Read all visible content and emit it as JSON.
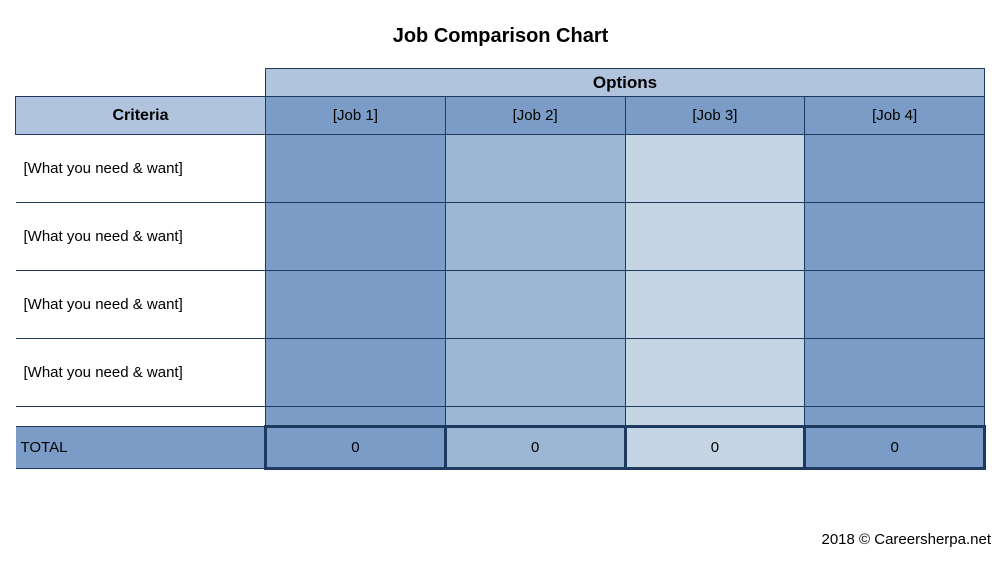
{
  "title": "Job Comparison Chart",
  "headers": {
    "options": "Options",
    "criteria": "Criteria",
    "jobs": [
      "[Job 1]",
      "[Job 2]",
      "[Job 3]",
      "[Job 4]"
    ]
  },
  "criteria_rows": [
    "[What you need & want]",
    "[What you need & want]",
    "[What you need & want]",
    "[What you need & want]"
  ],
  "total": {
    "label": "TOTAL",
    "values": [
      "0",
      "0",
      "0",
      "0"
    ]
  },
  "footer": "2018 © Careersherpa.net",
  "chart_data": {
    "type": "table",
    "title": "Job Comparison Chart",
    "columns": [
      "Criteria",
      "[Job 1]",
      "[Job 2]",
      "[Job 3]",
      "[Job 4]"
    ],
    "rows": [
      [
        "[What you need & want]",
        "",
        "",
        "",
        ""
      ],
      [
        "[What you need & want]",
        "",
        "",
        "",
        ""
      ],
      [
        "[What you need & want]",
        "",
        "",
        "",
        ""
      ],
      [
        "[What you need & want]",
        "",
        "",
        "",
        ""
      ]
    ],
    "totals": [
      "TOTAL",
      0,
      0,
      0,
      0
    ]
  }
}
